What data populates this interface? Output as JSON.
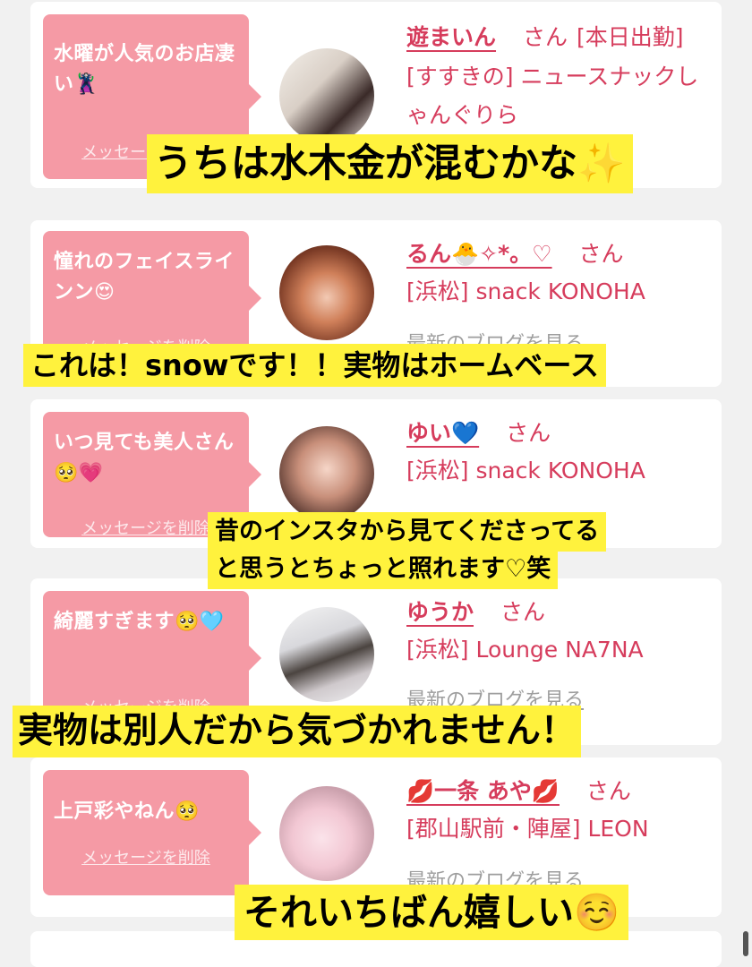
{
  "colors": {
    "accent": "#d63c5c",
    "bubble": "#f59aa5",
    "caption_bg": "#fff23d"
  },
  "delete_label": "メッセージを削除",
  "san_label": "さん",
  "blog_label": "最新のブログを見る",
  "cards": [
    {
      "message": "水曜が人気のお店凄い🦹",
      "name": "遊まいん",
      "status": "[本日出勤]",
      "shop": "[すすきの] ニュースナックしゃんぐりら",
      "avatar": "avatar-photo"
    },
    {
      "message": "憧れのフェイスラインン😍",
      "name": "るん🐣✧*。♡",
      "shop": "[浜松] snack KONOHA",
      "avatar": "avatar-photo"
    },
    {
      "message": "いつ見ても美人さん🥺💗",
      "name": "ゆい💙",
      "shop": "[浜松] snack KONOHA",
      "avatar": "avatar-photo"
    },
    {
      "message": "綺麗すぎます🥺🩵",
      "name": "ゆうか",
      "shop": "[浜松] Lounge NA7NA",
      "avatar": "avatar-photo"
    },
    {
      "message": "上戸彩やねん🥺",
      "name": "💋一条 あや💋",
      "shop": "[郡山駅前・陣屋] LEON",
      "avatar": "avatar-photo"
    }
  ],
  "captions": [
    "うちは水木金が混むかな✨",
    "これは！snowです！！実物はホームベース",
    "昔のインスタから見てくださってる",
    "と思うとちょっと照れます♡笑",
    "実物は別人だから気づかれません！",
    "それいちばん嬉しい☺️"
  ]
}
